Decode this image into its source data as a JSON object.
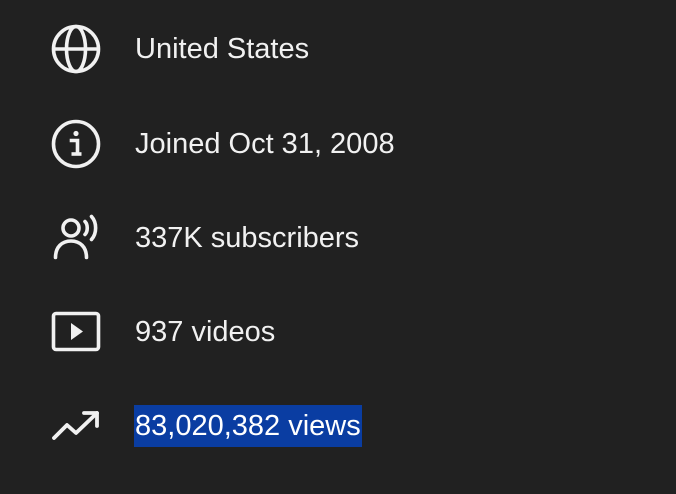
{
  "about": {
    "items": [
      {
        "icon": "globe-icon",
        "label": "United States"
      },
      {
        "icon": "info-icon",
        "label": "Joined Oct 31, 2008"
      },
      {
        "icon": "subscribers-icon",
        "label": "337K subscribers"
      },
      {
        "icon": "video-icon",
        "label": "937 videos"
      },
      {
        "icon": "trending-up-icon",
        "label": "83,020,382 views",
        "selected": true
      }
    ]
  },
  "colors": {
    "background": "#212121",
    "text": "#f1f1f1",
    "selection": "#0a3da2"
  }
}
